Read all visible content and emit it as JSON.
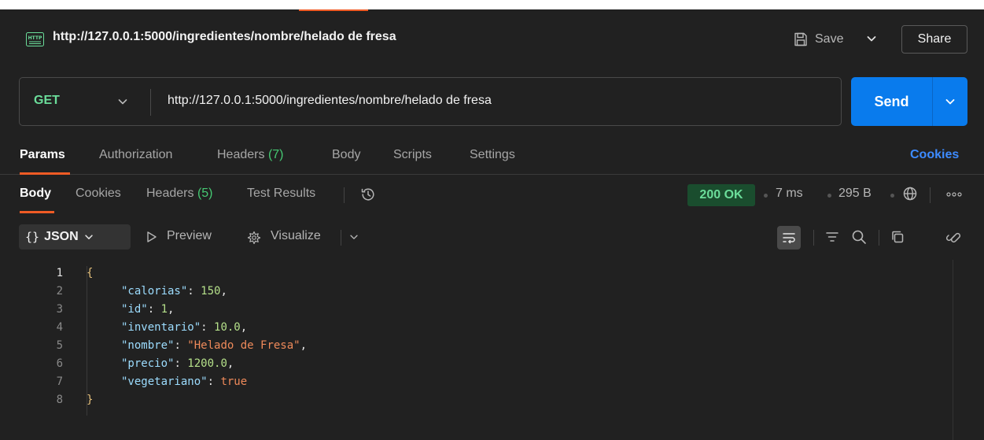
{
  "window": {
    "request_title": "http://127.0.0.1:5000/ingredientes/nombre/helado de fresa",
    "save_label": "Save",
    "share_label": "Share"
  },
  "request": {
    "method": "GET",
    "url": "http://127.0.0.1:5000/ingredientes/nombre/helado de fresa",
    "send_label": "Send"
  },
  "request_tabs": {
    "params": "Params",
    "authorization": "Authorization",
    "headers": "Headers",
    "headers_count": "(7)",
    "body": "Body",
    "scripts": "Scripts",
    "settings": "Settings",
    "cookies_link": "Cookies"
  },
  "response_tabs": {
    "body": "Body",
    "cookies": "Cookies",
    "headers": "Headers",
    "headers_count": "(5)",
    "test_results": "Test Results"
  },
  "response_meta": {
    "status": "200 OK",
    "time": "7 ms",
    "size": "295 B"
  },
  "body_toolbar": {
    "format_braces": "{}",
    "format": "JSON",
    "preview": "Preview",
    "visualize": "Visualize"
  },
  "code_lines": [
    {
      "n": "1",
      "text": "{"
    },
    {
      "n": "2",
      "key": "\"calorias\"",
      "value": "150",
      "type": "num",
      "comma": true
    },
    {
      "n": "3",
      "key": "\"id\"",
      "value": "1",
      "type": "num",
      "comma": true
    },
    {
      "n": "4",
      "key": "\"inventario\"",
      "value": "10.0",
      "type": "num",
      "comma": true
    },
    {
      "n": "5",
      "key": "\"nombre\"",
      "value": "\"Helado de Fresa\"",
      "type": "str",
      "comma": true
    },
    {
      "n": "6",
      "key": "\"precio\"",
      "value": "1200.0",
      "type": "num",
      "comma": true
    },
    {
      "n": "7",
      "key": "\"vegetariano\"",
      "value": "true",
      "type": "bool",
      "comma": false
    },
    {
      "n": "8",
      "text": "}"
    }
  ],
  "icons": {
    "http": "http-file-icon",
    "save": "save-icon",
    "history": "history-icon",
    "globe": "globe-icon",
    "more": "more-icon",
    "wrap": "wrap-lines-icon",
    "filter": "filter-icon",
    "search": "search-icon",
    "copy": "copy-icon",
    "link": "link-icon"
  },
  "colors": {
    "accent": "#ef5b25",
    "send": "#097bed",
    "method_get": "#6bdd9a",
    "status_ok_bg": "#1a4d2e",
    "cookies_link": "#3d8bff"
  }
}
